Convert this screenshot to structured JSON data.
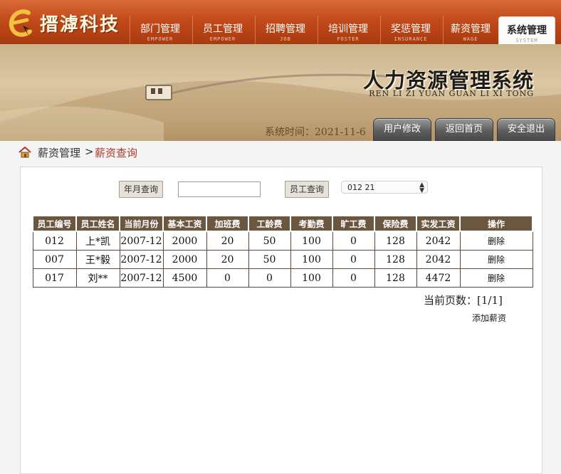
{
  "brand": {
    "name": "搢滹科技"
  },
  "nav": [
    {
      "label": "部门管理",
      "sub": "EMPOWER"
    },
    {
      "label": "员工管理",
      "sub": "EMPOWER"
    },
    {
      "label": "招聘管理",
      "sub": "JOB"
    },
    {
      "label": "培训管理",
      "sub": "FOSTER"
    },
    {
      "label": "奖惩管理",
      "sub": "INSURANCE"
    },
    {
      "label": "薪资管理",
      "sub": "WAGE"
    },
    {
      "label": "系统管理",
      "sub": "SYSTEM"
    }
  ],
  "banner": {
    "title": "人力资源管理系统",
    "pinyin": "REN LI ZI YUAN GUAN LI XI TONG",
    "time_label": "系统时间：",
    "time_value": "2021-11-6",
    "buttons": [
      "用户修改",
      "返回首页",
      "安全退出"
    ]
  },
  "breadcrumb": {
    "parent": "薪资管理",
    "separator": ">",
    "current": "薪资查询"
  },
  "search": {
    "month_button": "年月查询",
    "month_value": "",
    "emp_button": "员工查询",
    "emp_selected": "012  21"
  },
  "table": {
    "headers": [
      "员工编号",
      "员工姓名",
      "当前月份",
      "基本工资",
      "加班费",
      "工龄费",
      "考勤费",
      "旷工费",
      "保险费",
      "实发工资",
      "操作"
    ],
    "rows": [
      [
        "012",
        "上*凯",
        "2007-12",
        "2000",
        "20",
        "50",
        "100",
        "0",
        "128",
        "2042",
        "删除"
      ],
      [
        "007",
        "王*毅",
        "2007-12",
        "2000",
        "20",
        "50",
        "100",
        "0",
        "128",
        "2042",
        "删除"
      ],
      [
        "017",
        "刘**",
        "2007-12",
        "4500",
        "0",
        "0",
        "100",
        "0",
        "128",
        "4472",
        "删除"
      ]
    ]
  },
  "pagination": {
    "label": "当前页数：",
    "value": "[1/1]"
  },
  "actions": {
    "add_salary": "添加薪资"
  },
  "colors": {
    "nav_bg": "#c24a1a",
    "table_header_bg": "#6b5640",
    "crumb_current": "#b0362a"
  }
}
